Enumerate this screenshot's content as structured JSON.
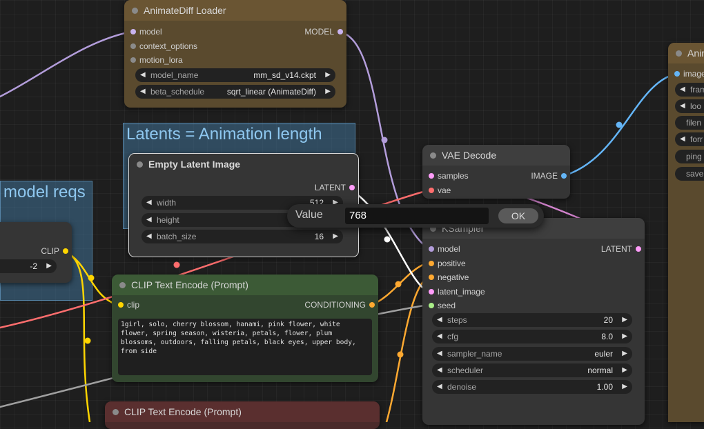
{
  "groups": {
    "latents": {
      "title": "Latents = Animation length"
    },
    "model_reqs": {
      "title": "model reqs"
    }
  },
  "nodes": {
    "animatediff_loader": {
      "title": "AnimateDiff Loader",
      "inputs": [
        "model",
        "context_options",
        "motion_lora"
      ],
      "output": "MODEL",
      "widgets": [
        {
          "label": "model_name",
          "value": "mm_sd_v14.ckpt"
        },
        {
          "label": "beta_schedule",
          "value": "sqrt_linear (AnimateDiff)"
        }
      ]
    },
    "empty_latent": {
      "title": "Empty Latent Image",
      "output": "LATENT",
      "widgets": [
        {
          "label": "width",
          "value": "512"
        },
        {
          "label": "height",
          "value": ""
        },
        {
          "label": "batch_size",
          "value": "16"
        }
      ]
    },
    "clip_node": {
      "output": "CLIP",
      "widget_value": "-2"
    },
    "clip_text_encode": {
      "title": "CLIP Text Encode (Prompt)",
      "input": "clip",
      "output": "CONDITIONING",
      "text": "1girl, solo, cherry blossom, hanami, pink flower, white flower, spring season, wisteria, petals, flower, plum blossoms, outdoors, falling petals, black eyes, upper body, from side"
    },
    "clip_text_encode_2": {
      "title": "CLIP Text Encode (Prompt)"
    },
    "vae_decode": {
      "title": "VAE Decode",
      "inputs": [
        "samples",
        "vae"
      ],
      "output": "IMAGE"
    },
    "ksampler": {
      "title": "KSampler",
      "inputs": [
        "model",
        "positive",
        "negative",
        "latent_image",
        "seed"
      ],
      "output": "LATENT",
      "widgets": [
        {
          "label": "steps",
          "value": "20"
        },
        {
          "label": "cfg",
          "value": "8.0"
        },
        {
          "label": "sampler_name",
          "value": "euler"
        },
        {
          "label": "scheduler",
          "value": "normal"
        },
        {
          "label": "denoise",
          "value": "1.00"
        }
      ]
    },
    "right_node": {
      "title": "Anim",
      "input": "image",
      "widgets": [
        "fram",
        "loo",
        "filen",
        "forr",
        "ping",
        "save"
      ]
    }
  },
  "prompt_dialog": {
    "label": "Value",
    "input_value": "768",
    "ok_label": "OK"
  },
  "colors": {
    "model": "#b39ddb",
    "clip": "#ffd500",
    "conditioning": "#ffa931",
    "latent": "#ff9cf9",
    "vae": "#ff6e6e",
    "image": "#64b5f6",
    "int": "#aaee88"
  }
}
